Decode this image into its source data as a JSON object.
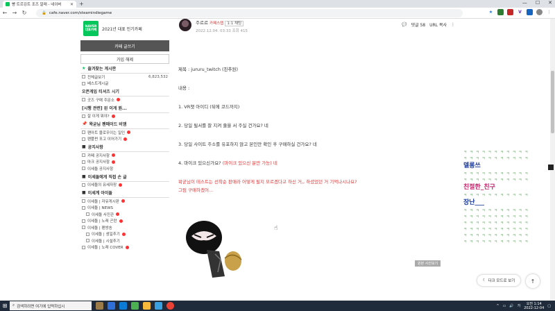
{
  "browser": {
    "tab_title": "빵 트르깅트 조즈 알래 - 네이버",
    "url": "cafe.naver.com/steamindiegame",
    "new_tab": "+",
    "min": "—",
    "max": "☐",
    "close": "✕"
  },
  "sidebar": {
    "badge_line1": "NAVER",
    "badge_line2": "대표카페",
    "brand_text": "2021년 대표 인기카페",
    "write_button": "카페 글쓰기",
    "join_button": "가입 해제",
    "fav_title": "즐겨찾는 게시판",
    "all_posts": "전체글보기",
    "all_posts_count": "6,823,532",
    "best_posts": "베스트게시글",
    "otm_title": "오픈게임 티셔츠 시기",
    "goods": "굿즈 구매 주문소",
    "notice_q": "[시행 관련] 왼 이게 뭔...",
    "notice_q_item": "잘 이게 뭐야?",
    "eol_title": "왁굳님 팬메이드 비앰",
    "eol_item1": "팬아트 블로우이는 일인",
    "eol_item2": "팬플펀 포고 이어가기",
    "announce_title": "공지사항",
    "announce1": "카페 공지사항",
    "announce2": "마크 공지사항",
    "announce3": "이세돌 공지사항",
    "direct_title": "이세돌에게 직접 손 글",
    "direct_item": "이세돌의 유세자장",
    "members_title": "이세계 아이돌",
    "member1": "이세돌 | 자유게시판",
    "member2": "이세돌 | NEWS",
    "member3": "이세돌 사진관",
    "member4": "이세돌 | 노래 곤란",
    "member5": "이세돌 | 팬방송",
    "member6": "이세돌 | 생일추기",
    "member7": "이세돌 | 시설추기",
    "member8": "이세돌 | 노래 COVER"
  },
  "article": {
    "author": "주르르",
    "author_level": "카페스탭",
    "author_tag": "1:1 채팅",
    "date": "2022.12.04. 03:33",
    "views": "조회 415",
    "comments": "댓글 58",
    "url_copy": "URL 복사",
    "title_line": "제목 : jururu_twitch (친추원)",
    "content_label": "내용 :",
    "line1": "1. VR챗 아이디 (뒤에 코드까지)",
    "line2": "2. 당일 될서를 잘 지켜 줄을 서 주실 건가요?  네",
    "line3": "3. 당일 사이트 주소를 유포하지 않고 본인만 확인 후 구매하실 건가요? 네",
    "line4a": "4. 마이크 있으신가요? ",
    "line4b": "(마이크 있으신 분만 가능) 네",
    "red1": "왁굳님이 테스트는 선착순 판매라 어떻게 될지 모르겠다고 하신 거,, 하셨었던 거 기억나시나요?",
    "red2": "그럼 구매하겠어...",
    "image_tag": "원본 사진보기"
  },
  "right_panel": {
    "k_row": "ㅋ ㅋ ㅋ ㅋ ㅋ ㅋ ㅋ ㅋ ㅋ ㅋ ㅋ",
    "name1": "델롱쓰",
    "name2": "친절한_친구",
    "name3": "장난___",
    "dark_mode": "다크 모드로 보기",
    "top": "↑"
  },
  "taskbar": {
    "search_placeholder": "검색하려면 여기에 입력하십시",
    "time": "오전 1:14",
    "date": "2022-12-04"
  },
  "colors": {
    "naver_green": "#03c75a",
    "red_text": "#dd3333",
    "name1": "#1a3a9a",
    "name2": "#c0246a",
    "name3": "#1a3a9a"
  }
}
